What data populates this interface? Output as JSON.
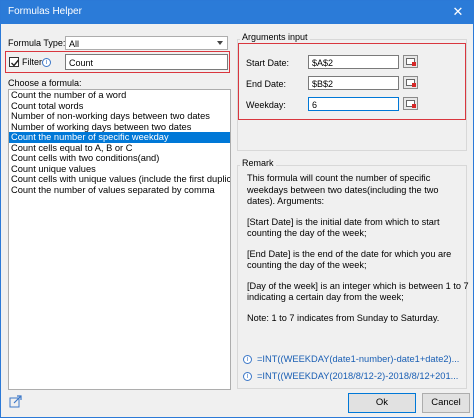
{
  "window": {
    "title": "Formulas Helper",
    "close_glyph": "✕"
  },
  "formula_type": {
    "label": "Formula Type:",
    "value": "All"
  },
  "filter": {
    "label": "Filter:",
    "value": "Count",
    "checked": true,
    "info_glyph": "i"
  },
  "choose": {
    "label": "Choose a formula:",
    "items": [
      "Count the number of a word",
      "Count total words",
      "Number of non-working days between two dates",
      "Number of working days between two dates",
      "Count the number of specific weekday",
      "Count cells equal to A, B or C",
      "Count cells with two conditions(and)",
      "Count unique values",
      "Count cells with unique values (include the first duplicate",
      "Count the number of values separated by comma"
    ],
    "selected_index": 4
  },
  "arguments": {
    "title": "Arguments input",
    "fields": [
      {
        "label": "Start Date:",
        "value": "$A$2"
      },
      {
        "label": "End Date:",
        "value": "$B$2"
      },
      {
        "label": "Weekday:",
        "value": "6"
      }
    ]
  },
  "remark": {
    "title": "Remark",
    "paragraphs": [
      "This formula will count the number of specific weekdays between two dates(including the two dates). Arguments:",
      "[Start Date] is the initial date from which to start counting the day of the week;",
      "[End Date] is the end of the date for which you are counting the day of the week;",
      "[Day of the week] is an integer which is between 1 to 7 indicating a certain day from the week;",
      "Note: 1 to 7 indicates from Sunday to Saturday."
    ],
    "formulas": [
      "=INT((WEEKDAY(date1-number)-date1+date2)...",
      "=INT((WEEKDAY(2018/8/12-2)-2018/8/12+201..."
    ]
  },
  "buttons": {
    "ok": "Ok",
    "cancel": "Cancel"
  },
  "colors": {
    "accent": "#2b7bd8",
    "highlight_border": "#d9363e",
    "selection": "#0078d7",
    "formula_text": "#1a5fb4"
  }
}
